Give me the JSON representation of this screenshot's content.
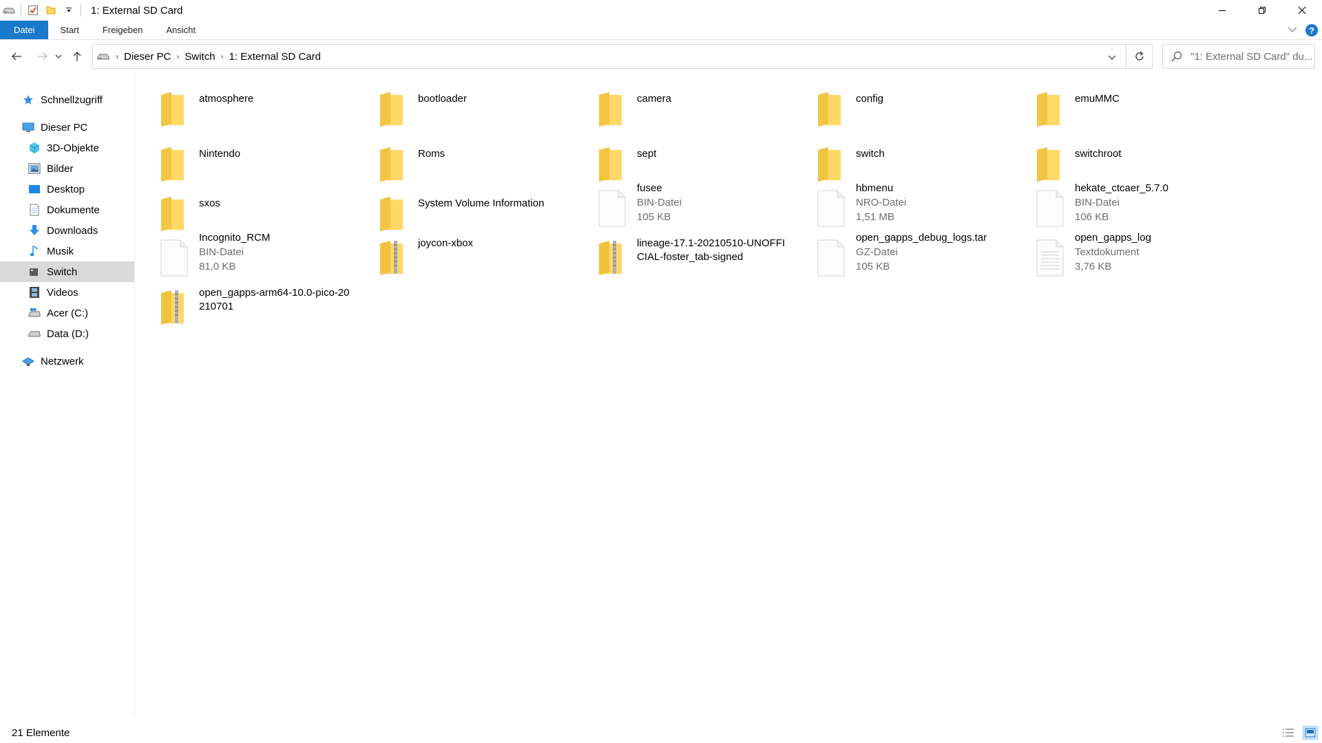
{
  "window": {
    "title": "1: External SD Card"
  },
  "ribbon": {
    "tabs": [
      "Datei",
      "Start",
      "Freigeben",
      "Ansicht"
    ]
  },
  "address": {
    "breadcrumbs": [
      "Dieser PC",
      "Switch",
      "1: External SD Card"
    ],
    "search_placeholder": "\"1: External SD Card\" du..."
  },
  "sidebar": {
    "items": [
      {
        "label": "Schnellzugriff",
        "icon": "star-icon"
      },
      {
        "label": "Dieser PC",
        "icon": "computer-icon"
      },
      {
        "label": "3D-Objekte",
        "icon": "cube-icon"
      },
      {
        "label": "Bilder",
        "icon": "pictures-icon"
      },
      {
        "label": "Desktop",
        "icon": "desktop-icon"
      },
      {
        "label": "Dokumente",
        "icon": "documents-icon"
      },
      {
        "label": "Downloads",
        "icon": "download-icon"
      },
      {
        "label": "Musik",
        "icon": "music-icon"
      },
      {
        "label": "Switch",
        "icon": "drive-icon"
      },
      {
        "label": "Videos",
        "icon": "film-icon"
      },
      {
        "label": "Acer (C:)",
        "icon": "system-drive-icon"
      },
      {
        "label": "Data (D:)",
        "icon": "drive-icon"
      },
      {
        "label": "Netzwerk",
        "icon": "network-icon"
      }
    ]
  },
  "files": [
    {
      "name": "atmosphere",
      "kind": "folder"
    },
    {
      "name": "bootloader",
      "kind": "folder"
    },
    {
      "name": "camera",
      "kind": "folder"
    },
    {
      "name": "config",
      "kind": "folder"
    },
    {
      "name": "emuMMC",
      "kind": "folder"
    },
    {
      "name": "Nintendo",
      "kind": "folder"
    },
    {
      "name": "Roms",
      "kind": "folder"
    },
    {
      "name": "sept",
      "kind": "folder"
    },
    {
      "name": "switch",
      "kind": "folder"
    },
    {
      "name": "switchroot",
      "kind": "folder"
    },
    {
      "name": "sxos",
      "kind": "folder"
    },
    {
      "name": "System Volume Information",
      "kind": "folder"
    },
    {
      "name": "fusee",
      "kind": "file",
      "type": "BIN-Datei",
      "size": "105 KB"
    },
    {
      "name": "hbmenu",
      "kind": "file",
      "type": "NRO-Datei",
      "size": "1,51 MB"
    },
    {
      "name": "hekate_ctcaer_5.7.0",
      "kind": "file",
      "type": "BIN-Datei",
      "size": "106 KB"
    },
    {
      "name": "Incognito_RCM",
      "kind": "file",
      "type": "BIN-Datei",
      "size": "81,0 KB"
    },
    {
      "name": "joycon-xbox",
      "kind": "zip"
    },
    {
      "name": "lineage-17.1-20210510-UNOFFICIAL-foster_tab-signed",
      "kind": "zip"
    },
    {
      "name": "open_gapps_debug_logs.tar",
      "kind": "file",
      "type": "GZ-Datei",
      "size": "105 KB"
    },
    {
      "name": "open_gapps_log",
      "kind": "text",
      "type": "Textdokument",
      "size": "3,76 KB"
    },
    {
      "name": "open_gapps-arm64-10.0-pico-20210701",
      "kind": "zip"
    }
  ],
  "status": {
    "count_text": "21 Elemente"
  },
  "colors": {
    "accent": "#1979ca",
    "folder": "#ffd866",
    "selected": "#d9d9d9"
  }
}
